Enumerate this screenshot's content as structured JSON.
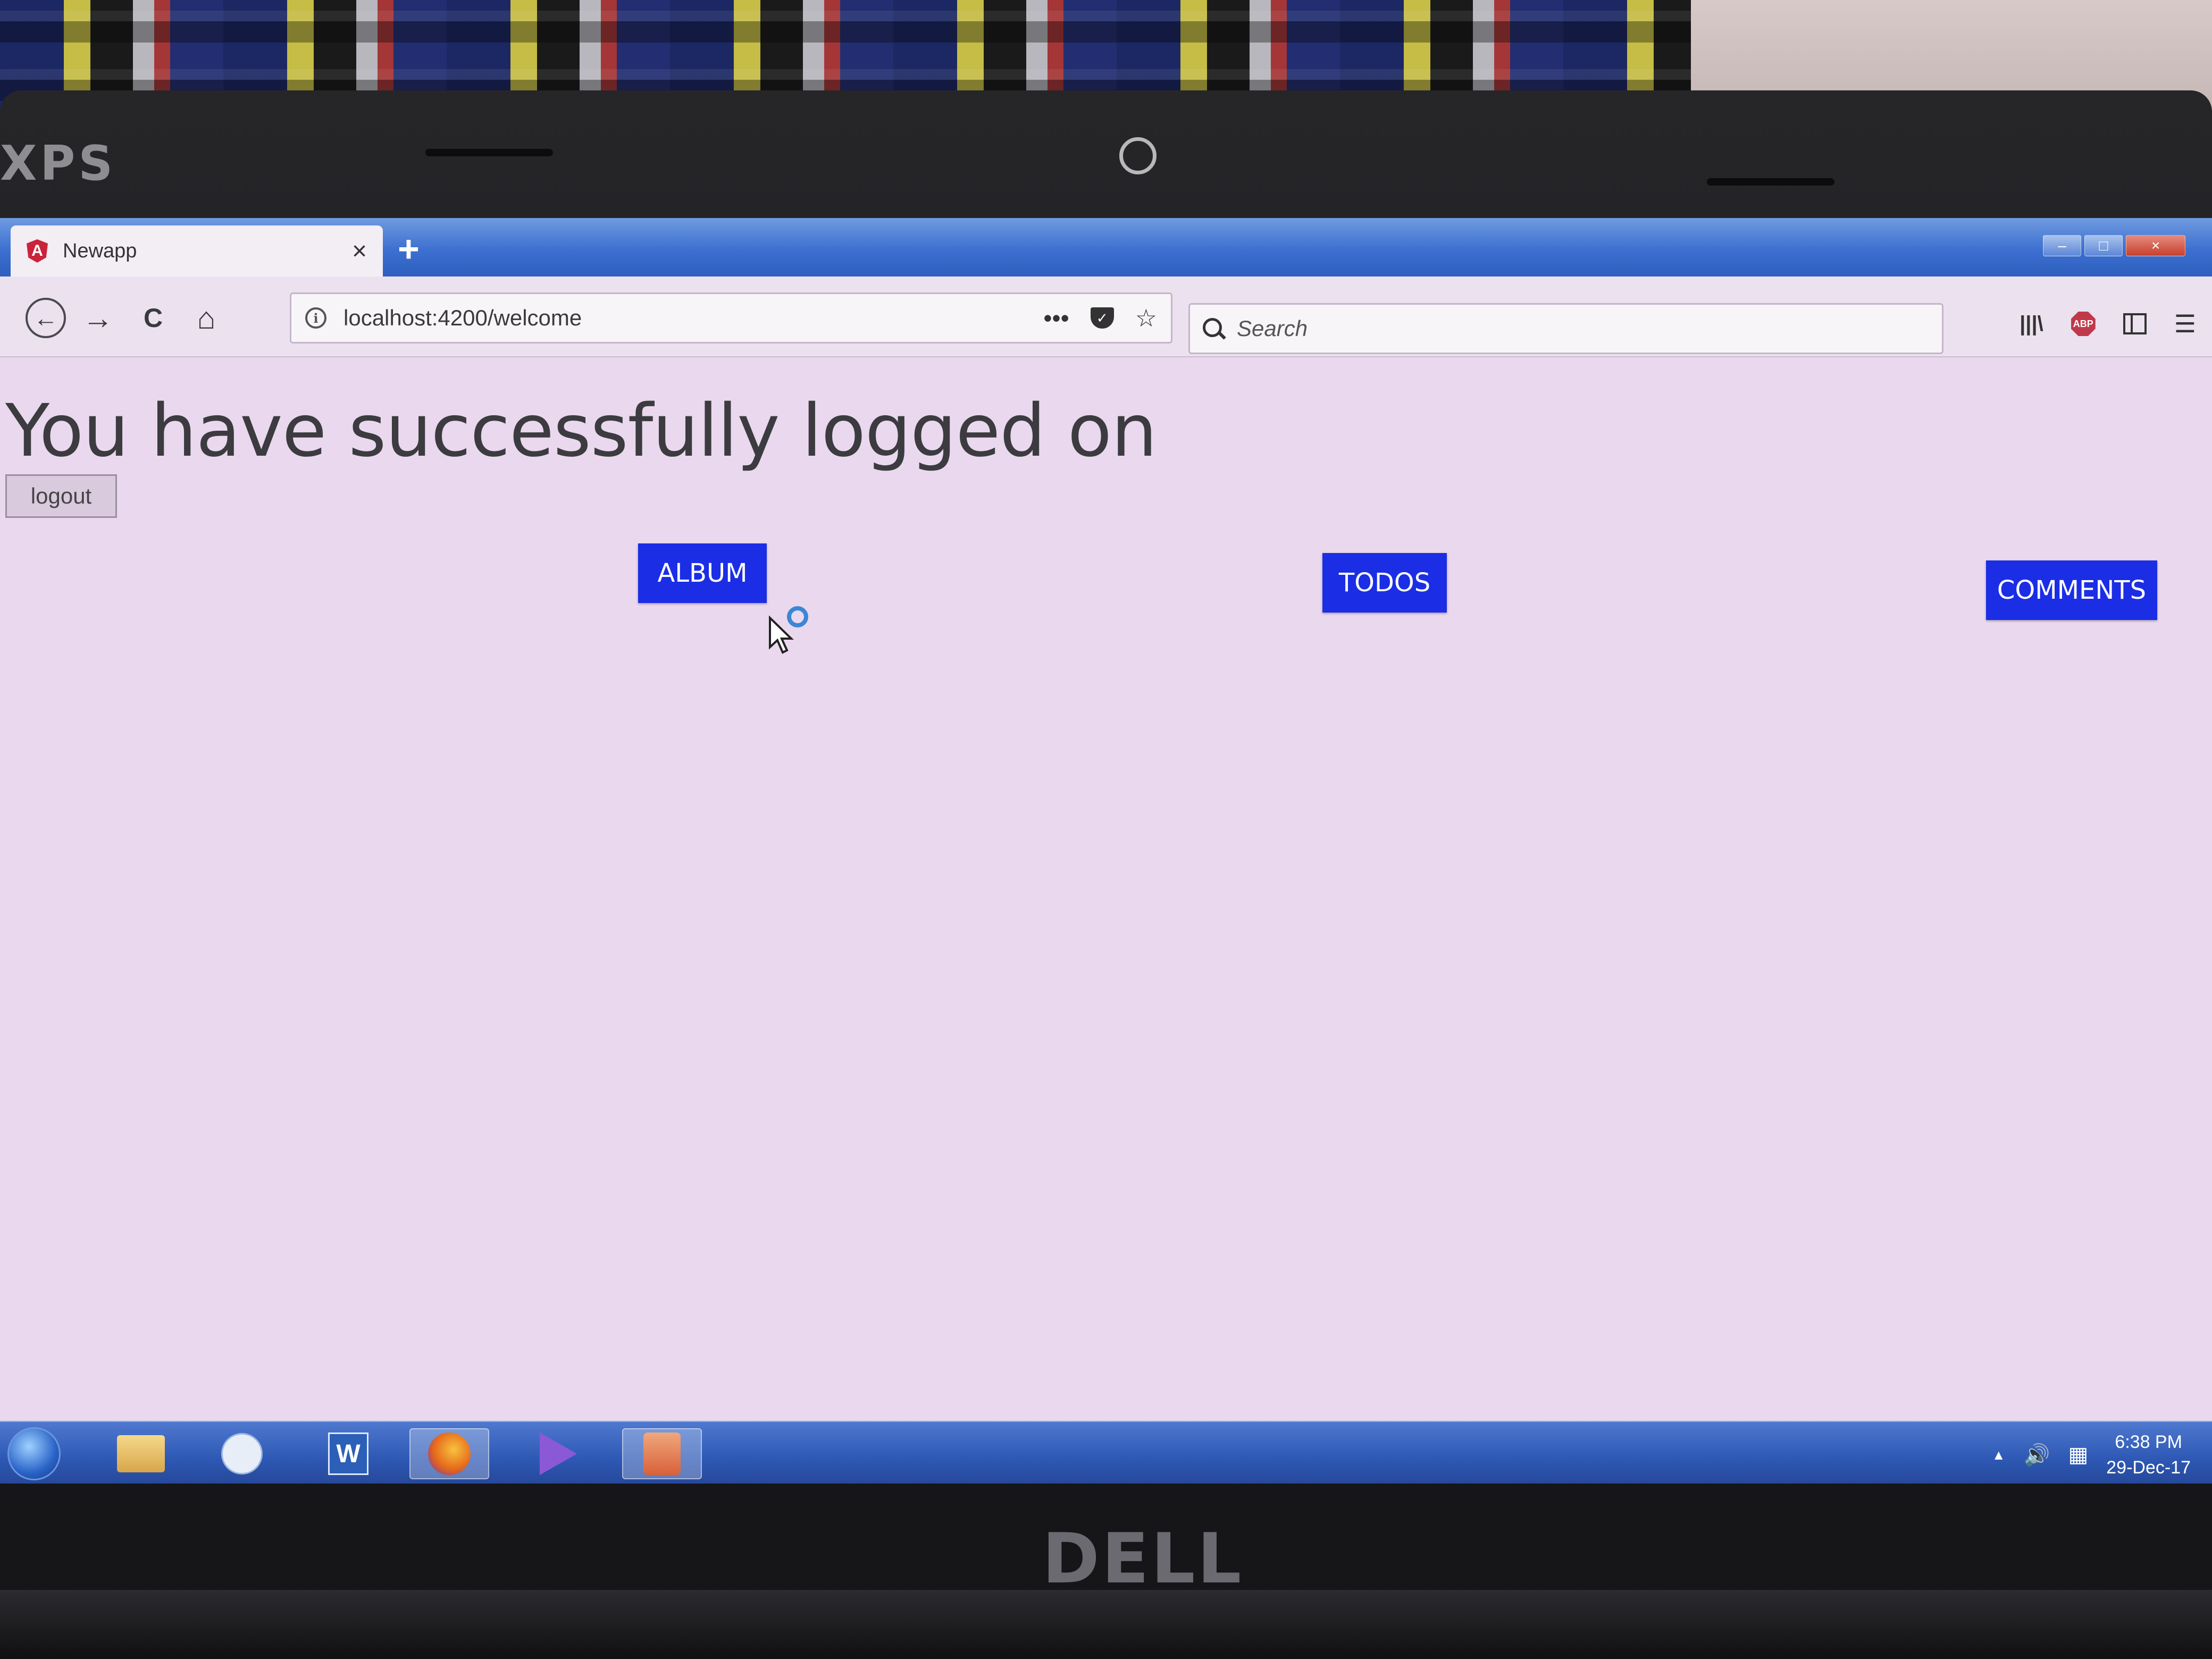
{
  "device": {
    "top_brand": "XPS",
    "bottom_brand": "DELL"
  },
  "browser": {
    "tab": {
      "title": "Newapp",
      "close": "×",
      "favicon": "A"
    },
    "new_tab": "+",
    "window_controls": {
      "minimize": "–",
      "maximize": "□",
      "close": "×"
    },
    "nav": {
      "back": "←",
      "forward": "→",
      "reload": "C",
      "home": "⌂"
    },
    "url": "localhost:4200/welcome",
    "url_actions": {
      "more": "•••",
      "bookmark": "☆"
    },
    "search": {
      "placeholder": "Search"
    },
    "tools": {
      "library": "|||\\",
      "abp": "ABP",
      "menu": "☰"
    }
  },
  "page": {
    "heading": "You have successfully logged on",
    "logout_label": "logout",
    "buttons": {
      "album": "ALBUM",
      "todos": "TODOS",
      "comments": "COMMENTS"
    },
    "accent_color": "#1b2ee6"
  },
  "taskbar": {
    "apps": [
      "start-orb",
      "file-explorer-icon",
      "skype-icon",
      "word-icon",
      "firefox-icon",
      "visual-studio-icon",
      "java-app-icon"
    ],
    "word_letter": "W",
    "tray": {
      "arrow": "▲",
      "volume": "🔊"
    },
    "clock": {
      "time": "6:38 PM",
      "date": "29-Dec-17"
    }
  }
}
